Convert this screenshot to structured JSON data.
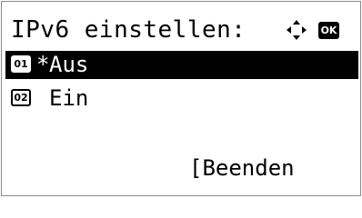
{
  "screen": {
    "title": "IPv6 einstellen:",
    "ok_label": "OK"
  },
  "menu": {
    "items": [
      {
        "number": "01",
        "marker": "*",
        "label": "Aus",
        "selected": true
      },
      {
        "number": "02",
        "marker": "",
        "label": "Ein",
        "selected": false
      }
    ]
  },
  "softkey": {
    "label": "[Beenden"
  },
  "icons": {
    "nav": "four-way-arrow-icon",
    "ok": "ok-key-icon"
  },
  "colors": {
    "selection_background": "#000000",
    "text": "#000000",
    "background": "#ffffff"
  }
}
